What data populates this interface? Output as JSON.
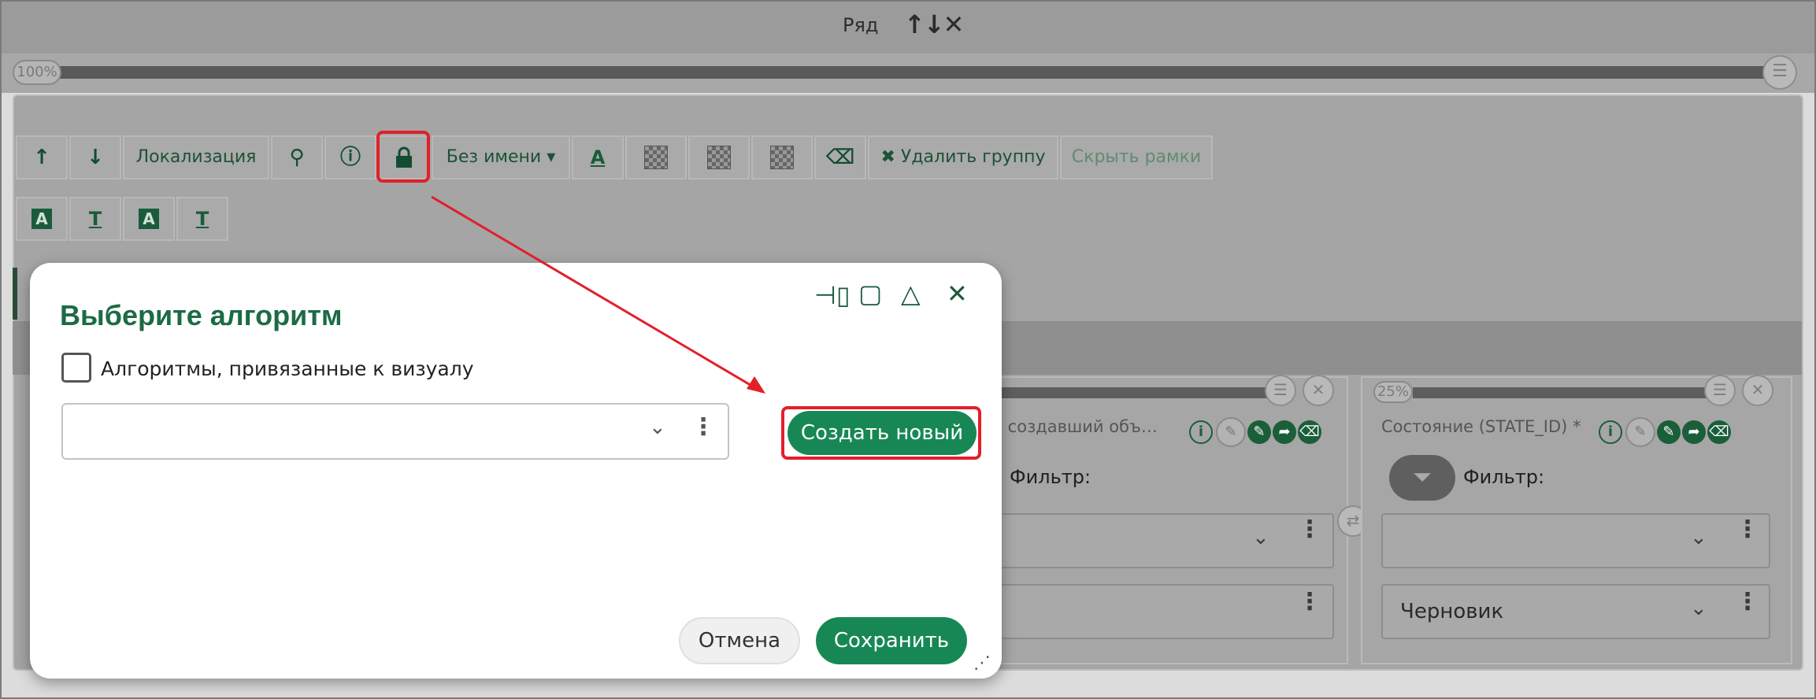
{
  "row": {
    "title": "Ряд",
    "arrows": "🠙🠛✕",
    "zoom": "100%"
  },
  "toolbar": {
    "up": "🠕",
    "down": "🠗",
    "localization": "Локализация",
    "binoculars": "⚲",
    "info": "ℹ",
    "lock": "🔒",
    "noname": "Без имени ▾",
    "text_color": "A",
    "eraser": "⌫",
    "delete_group": "✖ Удалить группу",
    "hide_frames": "Скрыть рамки",
    "format": [
      "A",
      "T",
      "A",
      "T"
    ]
  },
  "columns": {
    "left": {
      "title": "ик, создавший объ…",
      "filter_label": "Фильтр:"
    },
    "right": {
      "percent": "25%",
      "title": "Состояние (STATE_ID) *",
      "filter_label": "Фильтр:",
      "value2": "Черновик"
    }
  },
  "dialog": {
    "title": "Выберите алгоритм",
    "checkbox_label": "Алгоритмы, привязанные к визуалу",
    "create_new": "Создать новый",
    "cancel": "Отмена",
    "save": "Сохранить",
    "controls": [
      "⊣▢",
      "▢",
      "△",
      "✕"
    ]
  }
}
